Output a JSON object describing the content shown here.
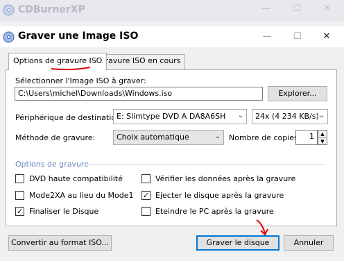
{
  "main_window": {
    "title": "CDBurnerXP"
  },
  "dialog": {
    "title": "Graver une Image ISO",
    "tabs": [
      {
        "label": "Options de gravure ISO",
        "selected": true
      },
      {
        "label": "Gravure ISO en cours",
        "selected": false
      }
    ],
    "iso_label": "Sélectionner l'Image ISO à graver:",
    "iso_path": "C:\\Users\\michel\\Downloads\\Windows.iso",
    "browse_button": "Explorer...",
    "destination_label": "Périphérique de destination:",
    "destination_value": "E: Slimtype DVD A  DA8A6SH",
    "speed_value": "24x (4 234 KB/s)",
    "method_label": "Méthode de gravure:",
    "method_value": "Choix automatique",
    "copies_label": "Nombre de copies:",
    "copies_value": "1",
    "options_group": "Options de gravure",
    "options": [
      {
        "label": "DVD haute compatibilité",
        "checked": false
      },
      {
        "label": "Vérifier les données après la gravure",
        "checked": false
      },
      {
        "label": "Mode2XA au lieu du Mode1",
        "checked": false
      },
      {
        "label": "Ejecter le disque après la gravure",
        "checked": true
      },
      {
        "label": "Finaliser le Disque",
        "checked": true
      },
      {
        "label": "Eteindre le PC après la gravure",
        "checked": false
      }
    ],
    "convert_button": "Convertir au format ISO...",
    "burn_button": "Graver le disque",
    "cancel_button": "Annuler"
  },
  "colors": {
    "accent": "#3c78c8",
    "annotation": "#e00000"
  }
}
